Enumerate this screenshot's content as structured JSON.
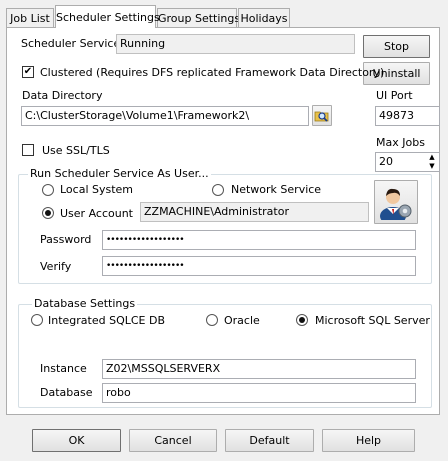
{
  "tabs": [
    {
      "label": "Job List"
    },
    {
      "label": "Scheduler Settings"
    },
    {
      "label": "Group Settings"
    },
    {
      "label": "Holidays"
    }
  ],
  "service": {
    "label": "Scheduler Service:",
    "status": "Running",
    "stop_label": "Stop",
    "uninstall_label": "Uninstall"
  },
  "clustered": {
    "checked": true,
    "label": "Clustered (Requires DFS replicated Framework Data Directory)"
  },
  "data_directory": {
    "label": "Data Directory",
    "value": "C:\\ClusterStorage\\Volume1\\Framework2\\"
  },
  "ui_port": {
    "label": "UI Port",
    "value": "49873"
  },
  "max_jobs": {
    "label": "Max Jobs",
    "value": "20"
  },
  "ssl": {
    "checked": false,
    "label": "Use SSL/TLS"
  },
  "run_as": {
    "legend": "Run Scheduler Service As User...",
    "local_system": "Local System",
    "network_service": "Network Service",
    "user_account": "User Account",
    "selected": "user_account",
    "account_value": "ZZMACHINE\\Administrator",
    "password_label": "Password",
    "password_value": "••••••••••••••••••",
    "verify_label": "Verify",
    "verify_value": "••••••••••••••••••"
  },
  "database": {
    "legend": "Database Settings",
    "options": [
      "Integrated SQLCE DB",
      "Oracle",
      "Microsoft SQL Server"
    ],
    "selected_index": 2,
    "instance_label": "Instance",
    "instance_value": "Z02\\MSSQLSERVERX",
    "database_label": "Database",
    "database_value": "robo"
  },
  "footer": {
    "ok": "OK",
    "cancel": "Cancel",
    "default": "Default",
    "help": "Help"
  }
}
